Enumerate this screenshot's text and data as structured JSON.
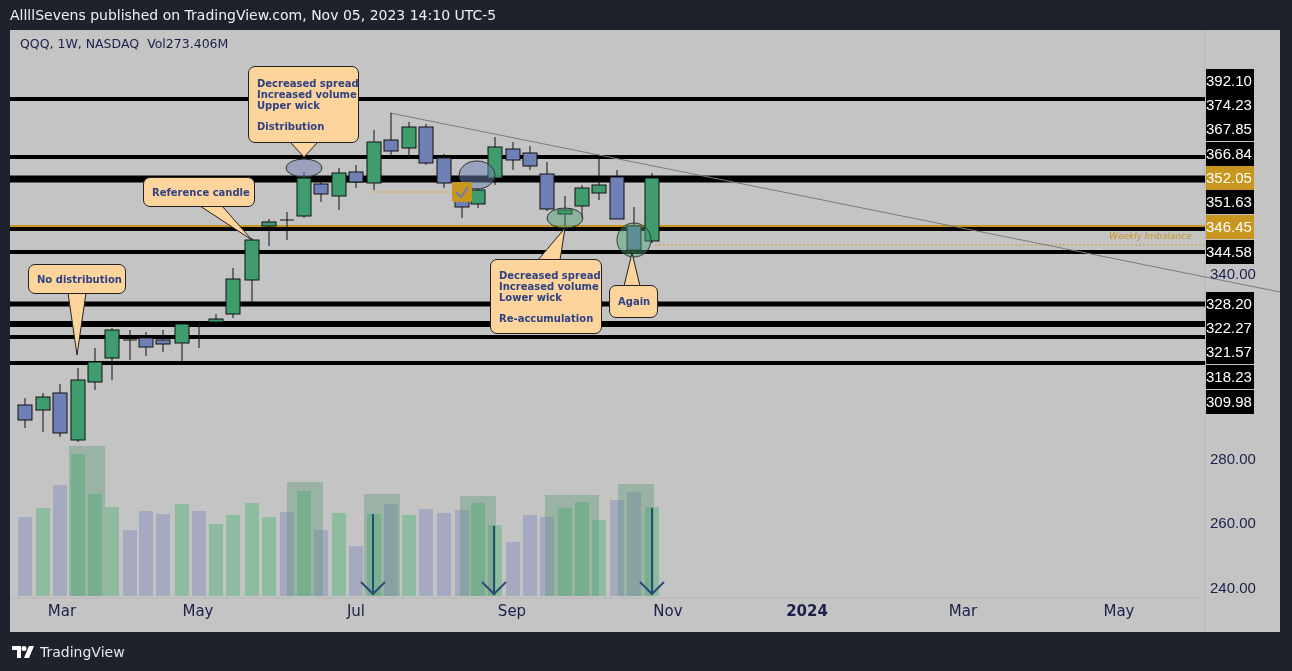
{
  "publisher_line": "AllllSevens published on TradingView.com, Nov 05, 2023 14:10 UTC-5",
  "chart": {
    "symbol": "QQQ, 1W, NASDAQ",
    "volume": "Vol273.406M",
    "price_labels": [
      {
        "text": "392.10",
        "color": "#000000"
      },
      {
        "text": "374.23",
        "color": "#000000"
      },
      {
        "text": "367.85",
        "color": "#000000"
      },
      {
        "text": "366.84",
        "color": "#000000"
      },
      {
        "text": "352.05",
        "color": "#c8961e"
      },
      {
        "text": "351.63",
        "color": "#000000"
      },
      {
        "text": "346.45",
        "color": "#c8961e"
      },
      {
        "text": "344.58",
        "color": "#000000"
      },
      {
        "text": "328.20",
        "color": "#000000"
      },
      {
        "text": "322.27",
        "color": "#000000"
      },
      {
        "text": "321.57",
        "color": "#000000"
      },
      {
        "text": "318.23",
        "color": "#000000"
      },
      {
        "text": "309.98",
        "color": "#000000"
      }
    ],
    "price_ticks": [
      "340.00",
      "280.00",
      "260.00",
      "240.00"
    ],
    "time_labels": [
      {
        "text": "Mar",
        "kind": "month"
      },
      {
        "text": "May",
        "kind": "month"
      },
      {
        "text": "Jul",
        "kind": "month"
      },
      {
        "text": "Sep",
        "kind": "month"
      },
      {
        "text": "Nov",
        "kind": "month"
      },
      {
        "text": "2024",
        "kind": "year"
      },
      {
        "text": "Mar",
        "kind": "month"
      },
      {
        "text": "May",
        "kind": "month"
      }
    ],
    "zone_label": "Weekly Imbalance",
    "callouts": [
      {
        "lines": [
          "Decreased spread",
          "Increased volume",
          "Upper wick"
        ],
        "conclusion": "Distribution"
      },
      {
        "lines": [
          "Reference candle"
        ]
      },
      {
        "lines": [
          "No distribution"
        ]
      },
      {
        "lines": [
          "Decreased spread",
          "Increased volume",
          "Lower wick"
        ],
        "conclusion": "Re-accumulation"
      },
      {
        "lines": [
          "Again"
        ]
      }
    ]
  },
  "footer": {
    "brand": "TradingView"
  }
}
